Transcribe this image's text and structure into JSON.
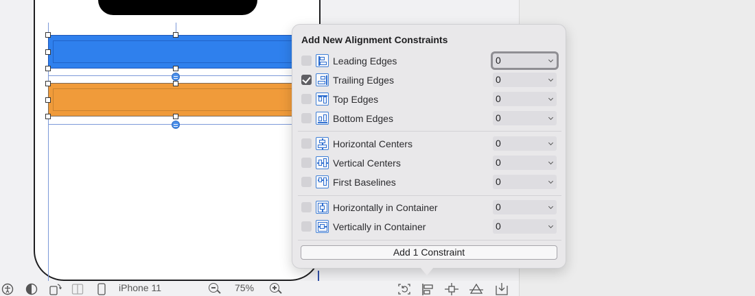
{
  "popover": {
    "title": "Add New Alignment Constraints",
    "groups": [
      [
        {
          "label": "Leading Edges",
          "checked": false,
          "value": "0",
          "icon": "leading-edges-icon",
          "focused": true
        },
        {
          "label": "Trailing Edges",
          "checked": true,
          "value": "0",
          "icon": "trailing-edges-icon"
        },
        {
          "label": "Top Edges",
          "checked": false,
          "value": "0",
          "icon": "top-edges-icon"
        },
        {
          "label": "Bottom Edges",
          "checked": false,
          "value": "0",
          "icon": "bottom-edges-icon"
        }
      ],
      [
        {
          "label": "Horizontal Centers",
          "checked": false,
          "value": "0",
          "icon": "horizontal-centers-icon"
        },
        {
          "label": "Vertical Centers",
          "checked": false,
          "value": "0",
          "icon": "vertical-centers-icon"
        },
        {
          "label": "First Baselines",
          "checked": false,
          "value": "0",
          "icon": "first-baselines-icon"
        }
      ],
      [
        {
          "label": "Horizontally in Container",
          "checked": false,
          "value": "0",
          "icon": "horizontally-in-container-icon"
        },
        {
          "label": "Vertically in Container",
          "checked": false,
          "value": "0",
          "icon": "vertically-in-container-icon"
        }
      ]
    ],
    "add_button": "Add 1 Constraint"
  },
  "toolbar": {
    "device": "iPhone 11",
    "zoom": "75%"
  },
  "colors": {
    "blue_view": "#2f80ed",
    "orange_view": "#f09b3a",
    "accent": "#2f6fd0"
  }
}
